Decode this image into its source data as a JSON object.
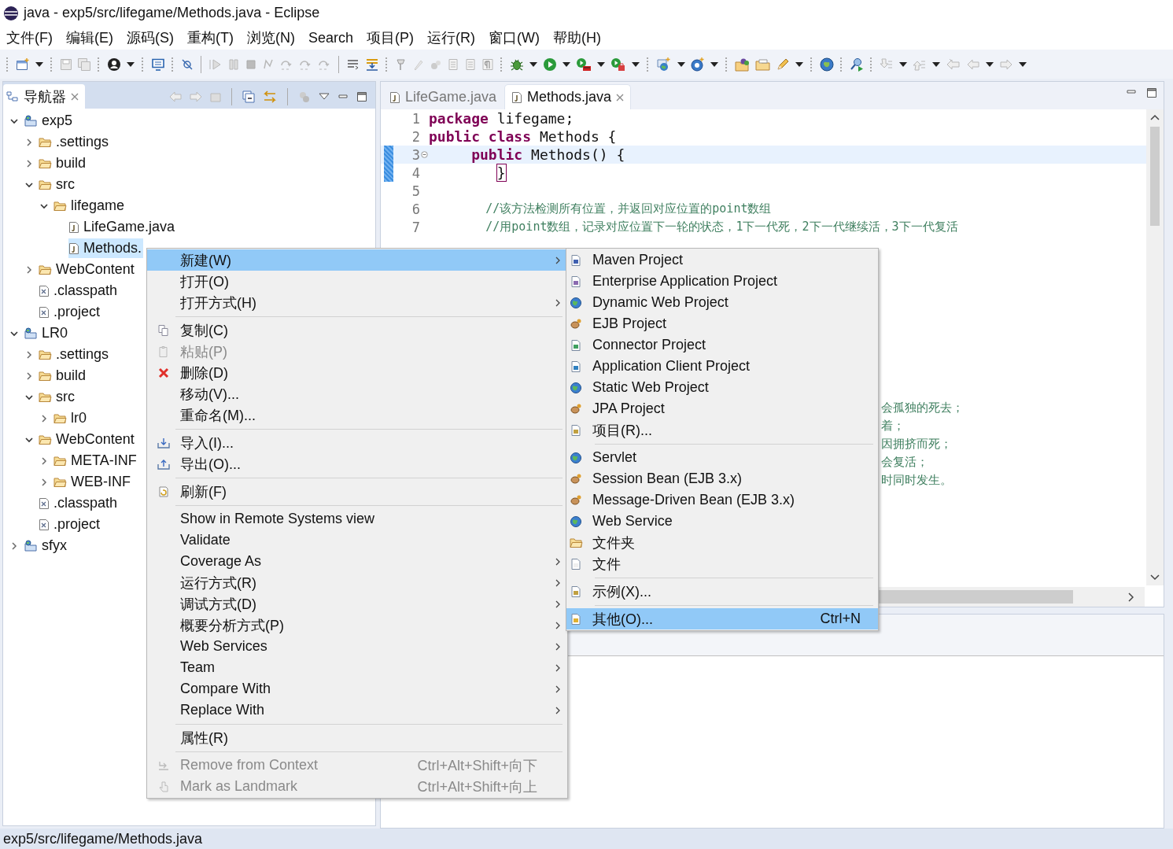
{
  "window": {
    "title": "java - exp5/src/lifegame/Methods.java - Eclipse"
  },
  "menu_bar": [
    "文件(F)",
    "编辑(E)",
    "源码(S)",
    "重构(T)",
    "浏览(N)",
    "Search",
    "项目(P)",
    "运行(R)",
    "窗口(W)",
    "帮助(H)"
  ],
  "navigator": {
    "tab": {
      "label": "导航器",
      "selected": true
    },
    "tree": [
      {
        "label": "exp5",
        "kind": "project",
        "expanded": true,
        "selected": false,
        "children": [
          {
            "label": ".settings",
            "kind": "folder",
            "expanded": false,
            "selected": false
          },
          {
            "label": "build",
            "kind": "folder",
            "expanded": false,
            "selected": false
          },
          {
            "label": "src",
            "kind": "folder",
            "expanded": true,
            "selected": false,
            "children": [
              {
                "label": "lifegame",
                "kind": "folder",
                "expanded": true,
                "selected": false,
                "children": [
                  {
                    "label": "LifeGame.java",
                    "kind": "java",
                    "selected": false
                  },
                  {
                    "label": "Methods.",
                    "kind": "java",
                    "selected": true
                  }
                ]
              }
            ]
          },
          {
            "label": "WebContent",
            "kind": "folder",
            "expanded": false,
            "selected": false
          },
          {
            "label": ".classpath",
            "kind": "xml",
            "selected": false
          },
          {
            "label": ".project",
            "kind": "xml",
            "selected": false
          }
        ]
      },
      {
        "label": "LR0",
        "kind": "project",
        "expanded": true,
        "selected": false,
        "children": [
          {
            "label": ".settings",
            "kind": "folder",
            "expanded": false,
            "selected": false
          },
          {
            "label": "build",
            "kind": "folder",
            "expanded": false,
            "selected": false
          },
          {
            "label": "src",
            "kind": "folder",
            "expanded": true,
            "selected": false,
            "children": [
              {
                "label": "lr0",
                "kind": "folder",
                "expanded": false,
                "selected": false
              }
            ]
          },
          {
            "label": "WebContent",
            "kind": "folder",
            "expanded": true,
            "selected": false,
            "children": [
              {
                "label": "META-INF",
                "kind": "folder",
                "expanded": false,
                "selected": false
              },
              {
                "label": "WEB-INF",
                "kind": "folder",
                "expanded": false,
                "selected": false
              }
            ]
          },
          {
            "label": ".classpath",
            "kind": "xml",
            "selected": false
          },
          {
            "label": ".project",
            "kind": "xml",
            "selected": false
          }
        ]
      },
      {
        "label": "sfyx",
        "kind": "project",
        "expanded": false,
        "selected": false
      }
    ]
  },
  "editor": {
    "tabs": [
      {
        "label": "LifeGame.java",
        "selected": false
      },
      {
        "label": "Methods.java",
        "selected": true
      }
    ],
    "lines": [
      {
        "number": "1",
        "current": false,
        "marked": false,
        "folding": false,
        "tokens": [
          {
            "kind": "keyword",
            "text": "package"
          },
          {
            "kind": "plain",
            "text": " lifegame;"
          }
        ]
      },
      {
        "number": "2",
        "current": false,
        "marked": false,
        "folding": false,
        "tokens": [
          {
            "kind": "keyword",
            "text": "public class"
          },
          {
            "kind": "plain",
            "text": " Methods {"
          }
        ]
      },
      {
        "number": "3",
        "current": true,
        "marked": true,
        "folding": true,
        "tokens": [
          {
            "kind": "keyword",
            "text": "     public"
          },
          {
            "kind": "plain",
            "text": " Methods() {"
          }
        ]
      },
      {
        "number": "4",
        "current": false,
        "marked": true,
        "folding": false,
        "tokens": [
          {
            "kind": "bracket",
            "text": "        }"
          }
        ]
      },
      {
        "number": "5",
        "current": false,
        "marked": false,
        "folding": false
      },
      {
        "number": "6",
        "current": false,
        "marked": false,
        "folding": false,
        "tokens": [
          {
            "kind": "comment",
            "text": "        //该方法检测所有位置，并返回对应位置的point数组"
          }
        ]
      },
      {
        "number": "7",
        "current": false,
        "marked": false,
        "folding": false,
        "tokens": [
          {
            "kind": "comment",
            "text": "        //用point数组，记录对应位置下一轮的状态，1下一代死，2下一代继续活，3下一代复活"
          }
        ]
      }
    ],
    "fragments": [
      "会孤独的死去；",
      "着；",
      "因拥挤而死；",
      "会复活；",
      "时同时发生。"
    ]
  },
  "context_menu": {
    "items": [
      {
        "kind": "item",
        "label": "新建(W)",
        "submenu": true,
        "disabled": false,
        "selected": true
      },
      {
        "kind": "item",
        "label": "打开(O)",
        "submenu": false,
        "disabled": false,
        "selected": false
      },
      {
        "kind": "item",
        "label": "打开方式(H)",
        "submenu": true,
        "disabled": false,
        "selected": false
      },
      {
        "kind": "separator"
      },
      {
        "kind": "item",
        "label": "复制(C)",
        "submenu": false,
        "disabled": false,
        "selected": false
      },
      {
        "kind": "item",
        "label": "粘贴(P)",
        "submenu": false,
        "disabled": true,
        "selected": false
      },
      {
        "kind": "item",
        "label": "删除(D)",
        "submenu": false,
        "disabled": false,
        "selected": false
      },
      {
        "kind": "item",
        "label": "移动(V)...",
        "submenu": false,
        "disabled": false,
        "selected": false
      },
      {
        "kind": "item",
        "label": "重命名(M)...",
        "submenu": false,
        "disabled": false,
        "selected": false
      },
      {
        "kind": "separator"
      },
      {
        "kind": "item",
        "label": "导入(I)...",
        "submenu": false,
        "disabled": false,
        "selected": false
      },
      {
        "kind": "item",
        "label": "导出(O)...",
        "submenu": false,
        "disabled": false,
        "selected": false
      },
      {
        "kind": "separator"
      },
      {
        "kind": "item",
        "label": "刷新(F)",
        "submenu": false,
        "disabled": false,
        "selected": false
      },
      {
        "kind": "separator"
      },
      {
        "kind": "item",
        "label": "Show in Remote Systems view",
        "submenu": false,
        "disabled": false,
        "selected": false
      },
      {
        "kind": "item",
        "label": "Validate",
        "submenu": false,
        "disabled": false,
        "selected": false
      },
      {
        "kind": "item",
        "label": "Coverage As",
        "submenu": true,
        "disabled": false,
        "selected": false
      },
      {
        "kind": "item",
        "label": "运行方式(R)",
        "submenu": true,
        "disabled": false,
        "selected": false
      },
      {
        "kind": "item",
        "label": "调试方式(D)",
        "submenu": true,
        "disabled": false,
        "selected": false
      },
      {
        "kind": "item",
        "label": "概要分析方式(P)",
        "submenu": true,
        "disabled": false,
        "selected": false
      },
      {
        "kind": "item",
        "label": "Web Services",
        "submenu": true,
        "disabled": false,
        "selected": false
      },
      {
        "kind": "item",
        "label": "Team",
        "submenu": true,
        "disabled": false,
        "selected": false
      },
      {
        "kind": "item",
        "label": "Compare With",
        "submenu": true,
        "disabled": false,
        "selected": false
      },
      {
        "kind": "item",
        "label": "Replace With",
        "submenu": true,
        "disabled": false,
        "selected": false
      },
      {
        "kind": "separator"
      },
      {
        "kind": "item",
        "label": "属性(R)",
        "submenu": false,
        "disabled": false,
        "selected": false
      },
      {
        "kind": "separator"
      },
      {
        "kind": "item",
        "label": "Remove from Context",
        "shortcut": "Ctrl+Alt+Shift+向下",
        "submenu": false,
        "disabled": true,
        "selected": false
      },
      {
        "kind": "item",
        "label": "Mark as Landmark",
        "shortcut": "Ctrl+Alt+Shift+向上",
        "submenu": false,
        "disabled": true,
        "selected": false
      }
    ]
  },
  "submenu": {
    "items": [
      {
        "kind": "item",
        "label": "Maven Project",
        "selected": false
      },
      {
        "kind": "item",
        "label": "Enterprise Application Project",
        "selected": false
      },
      {
        "kind": "item",
        "label": "Dynamic Web Project",
        "selected": false
      },
      {
        "kind": "item",
        "label": "EJB Project",
        "selected": false
      },
      {
        "kind": "item",
        "label": "Connector Project",
        "selected": false
      },
      {
        "kind": "item",
        "label": "Application Client Project",
        "selected": false
      },
      {
        "kind": "item",
        "label": "Static Web Project",
        "selected": false
      },
      {
        "kind": "item",
        "label": "JPA Project",
        "selected": false
      },
      {
        "kind": "item",
        "label": "项目(R)...",
        "selected": false
      },
      {
        "kind": "separator"
      },
      {
        "kind": "item",
        "label": "Servlet",
        "selected": false
      },
      {
        "kind": "item",
        "label": "Session Bean (EJB 3.x)",
        "selected": false
      },
      {
        "kind": "item",
        "label": "Message-Driven Bean (EJB 3.x)",
        "selected": false
      },
      {
        "kind": "item",
        "label": "Web Service",
        "selected": false
      },
      {
        "kind": "item",
        "label": "文件夹",
        "selected": false
      },
      {
        "kind": "item",
        "label": "文件",
        "selected": false
      },
      {
        "kind": "separator"
      },
      {
        "kind": "item",
        "label": "示例(X)...",
        "selected": false
      },
      {
        "kind": "separator"
      },
      {
        "kind": "item",
        "label": "其他(O)...",
        "shortcut": "Ctrl+N",
        "selected": true
      }
    ]
  },
  "status_bar": {
    "path": "exp5/src/lifegame/Methods.java"
  }
}
